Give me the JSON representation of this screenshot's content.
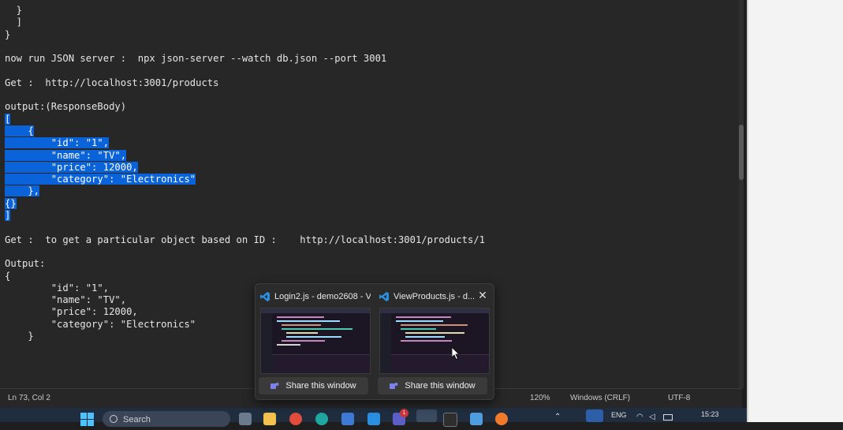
{
  "editor": {
    "lines": [
      {
        "text": "  }",
        "selected": false
      },
      {
        "text": "  ]",
        "selected": false
      },
      {
        "text": "}",
        "selected": false
      },
      {
        "text": "",
        "selected": false
      },
      {
        "text": "now run JSON server :  npx json-server --watch db.json --port 3001",
        "selected": false
      },
      {
        "text": "",
        "selected": false
      },
      {
        "text": "Get :  http://localhost:3001/products",
        "selected": false
      },
      {
        "text": "",
        "selected": false
      },
      {
        "text": "output:(ResponseBody)",
        "selected": false
      },
      {
        "text": "[",
        "selected": true
      },
      {
        "text": "    {",
        "selected": true
      },
      {
        "text": "        \"id\": \"1\",",
        "selected": true
      },
      {
        "text": "        \"name\": \"TV\",",
        "selected": true
      },
      {
        "text": "        \"price\": 12000,",
        "selected": true
      },
      {
        "text": "        \"category\": \"Electronics\"",
        "selected": true
      },
      {
        "text": "    },",
        "selected": true
      },
      {
        "text": "{}",
        "selected": true
      },
      {
        "text": "]",
        "selected": true
      },
      {
        "text": "",
        "selected": false
      },
      {
        "text": "Get :  to get a particular object based on ID :    http://localhost:3001/products/1",
        "selected": false
      },
      {
        "text": "",
        "selected": false
      },
      {
        "text": "Output:",
        "selected": false
      },
      {
        "text": "{",
        "selected": false
      },
      {
        "text": "        \"id\": \"1\",",
        "selected": false
      },
      {
        "text": "        \"name\": \"TV\",",
        "selected": false
      },
      {
        "text": "        \"price\": 12000,",
        "selected": false
      },
      {
        "text": "        \"category\": \"Electronics\"",
        "selected": false
      },
      {
        "text": "    }",
        "selected": false
      }
    ]
  },
  "statusbar": {
    "position": "Ln 73, Col 2",
    "zoom": "120%",
    "line_ending": "Windows (CRLF)",
    "encoding": "UTF-8"
  },
  "popup": {
    "windows": [
      {
        "title": "Login2.js - demo2608 - Vi...",
        "share_label": "Share this window"
      },
      {
        "title": "ViewProducts.js - d...",
        "share_label": "Share this window"
      }
    ],
    "close_glyph": "✕"
  },
  "taskbar": {
    "search_placeholder": "Search",
    "teams_badge": "1",
    "language": "ENG",
    "time": "15:23"
  },
  "colors": {
    "selection": "#0a63d8",
    "editor_bg": "#272727",
    "vscode_blue": "#2b8fe0",
    "taskbar_bg": "#1f2d3e"
  }
}
